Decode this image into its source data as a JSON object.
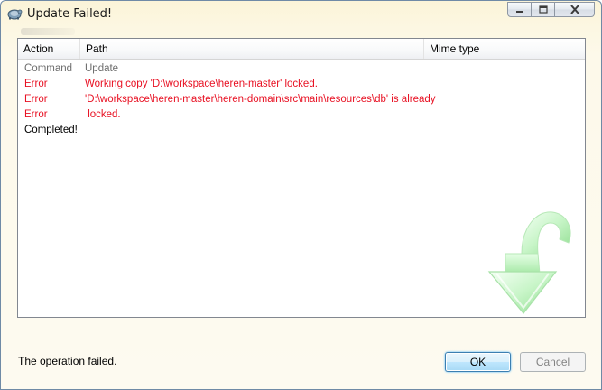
{
  "window": {
    "title": "Update Failed!",
    "icon": "tortoise-svn-icon"
  },
  "caption_buttons": {
    "minimize": "minimize-icon",
    "maximize": "maximize-icon",
    "close": "close-icon"
  },
  "log_table": {
    "columns": [
      "Action",
      "Path",
      "Mime type"
    ],
    "rows": [
      {
        "action": "Command",
        "path": "Update",
        "style": "gray"
      },
      {
        "action": "Error",
        "path": "Working copy 'D:\\workspace\\heren-master' locked.",
        "style": "red"
      },
      {
        "action": "Error",
        "path": "'D:\\workspace\\heren-master\\heren-domain\\src\\main\\resources\\db' is already",
        "style": "red"
      },
      {
        "action": "Error",
        "path": " locked.",
        "style": "red"
      },
      {
        "action": "Completed!",
        "path": "",
        "style": "black"
      }
    ]
  },
  "status": {
    "message": "The operation failed."
  },
  "buttons": {
    "ok_label_prefix": "",
    "ok_label_mnemonic": "O",
    "ok_label_suffix": "K",
    "cancel_label": "Cancel"
  },
  "colors": {
    "error": "#e81123",
    "muted": "#6d6d6d",
    "arrow_green": "#9be69b"
  }
}
